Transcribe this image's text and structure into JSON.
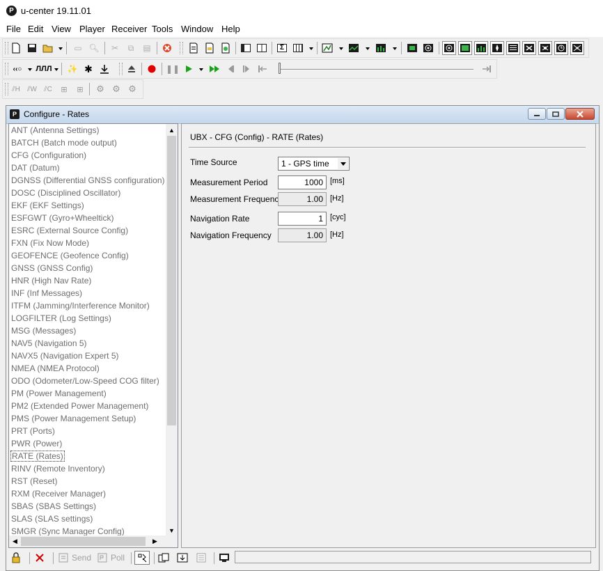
{
  "app": {
    "title": "u-center 19.11.01",
    "logo_letter": "P"
  },
  "menu": [
    "File",
    "Edit",
    "View",
    "Player",
    "Receiver",
    "Tools",
    "Window",
    "Help"
  ],
  "player": {
    "progress": 0.0
  },
  "child": {
    "title": "Configure - Rates",
    "logo_letter": "P"
  },
  "list": {
    "selected_index": 26,
    "items": [
      "ANT (Antenna Settings)",
      "BATCH (Batch mode output)",
      "CFG (Configuration)",
      "DAT (Datum)",
      "DGNSS (Differential GNSS configuration)",
      "DOSC (Disciplined Oscillator)",
      "EKF (EKF Settings)",
      "ESFGWT (Gyro+Wheeltick)",
      "ESRC (External Source Config)",
      "FXN (Fix Now Mode)",
      "GEOFENCE (Geofence Config)",
      "GNSS (GNSS Config)",
      "HNR (High Nav Rate)",
      "INF (Inf Messages)",
      "ITFM (Jamming/Interference Monitor)",
      "LOGFILTER (Log Settings)",
      "MSG (Messages)",
      "NAV5 (Navigation 5)",
      "NAVX5 (Navigation Expert 5)",
      "NMEA (NMEA Protocol)",
      "ODO (Odometer/Low-Speed COG filter)",
      "PM (Power Management)",
      "PM2 (Extended Power Management)",
      "PMS (Power Management Setup)",
      "PRT (Ports)",
      "PWR (Power)",
      "RATE (Rates)",
      "RINV (Remote Inventory)",
      "RST (Reset)",
      "RXM (Receiver Manager)",
      "SBAS (SBAS Settings)",
      "SLAS (SLAS settings)",
      "SMGR (Sync Manager Config)"
    ]
  },
  "panel": {
    "title": "UBX - CFG (Config) - RATE (Rates)",
    "time_source": {
      "label": "Time Source",
      "value": "1 - GPS time"
    },
    "measurement_period": {
      "label": "Measurement Period",
      "value": "1000",
      "unit": "[ms]"
    },
    "measurement_frequency": {
      "label": "Measurement Frequency",
      "value": "1.00",
      "unit": "[Hz]"
    },
    "navigation_rate": {
      "label": "Navigation Rate",
      "value": "1",
      "unit": "[cyc]"
    },
    "navigation_frequency": {
      "label": "Navigation Frequency",
      "value": "1.00",
      "unit": "[Hz]"
    }
  },
  "bottom": {
    "send_label": "Send",
    "poll_label": "Poll"
  },
  "colors": {
    "record": "#e00000",
    "play": "#1aa31a",
    "titlebar_child": "#c4d8ee",
    "close_button": "#c9472f"
  }
}
